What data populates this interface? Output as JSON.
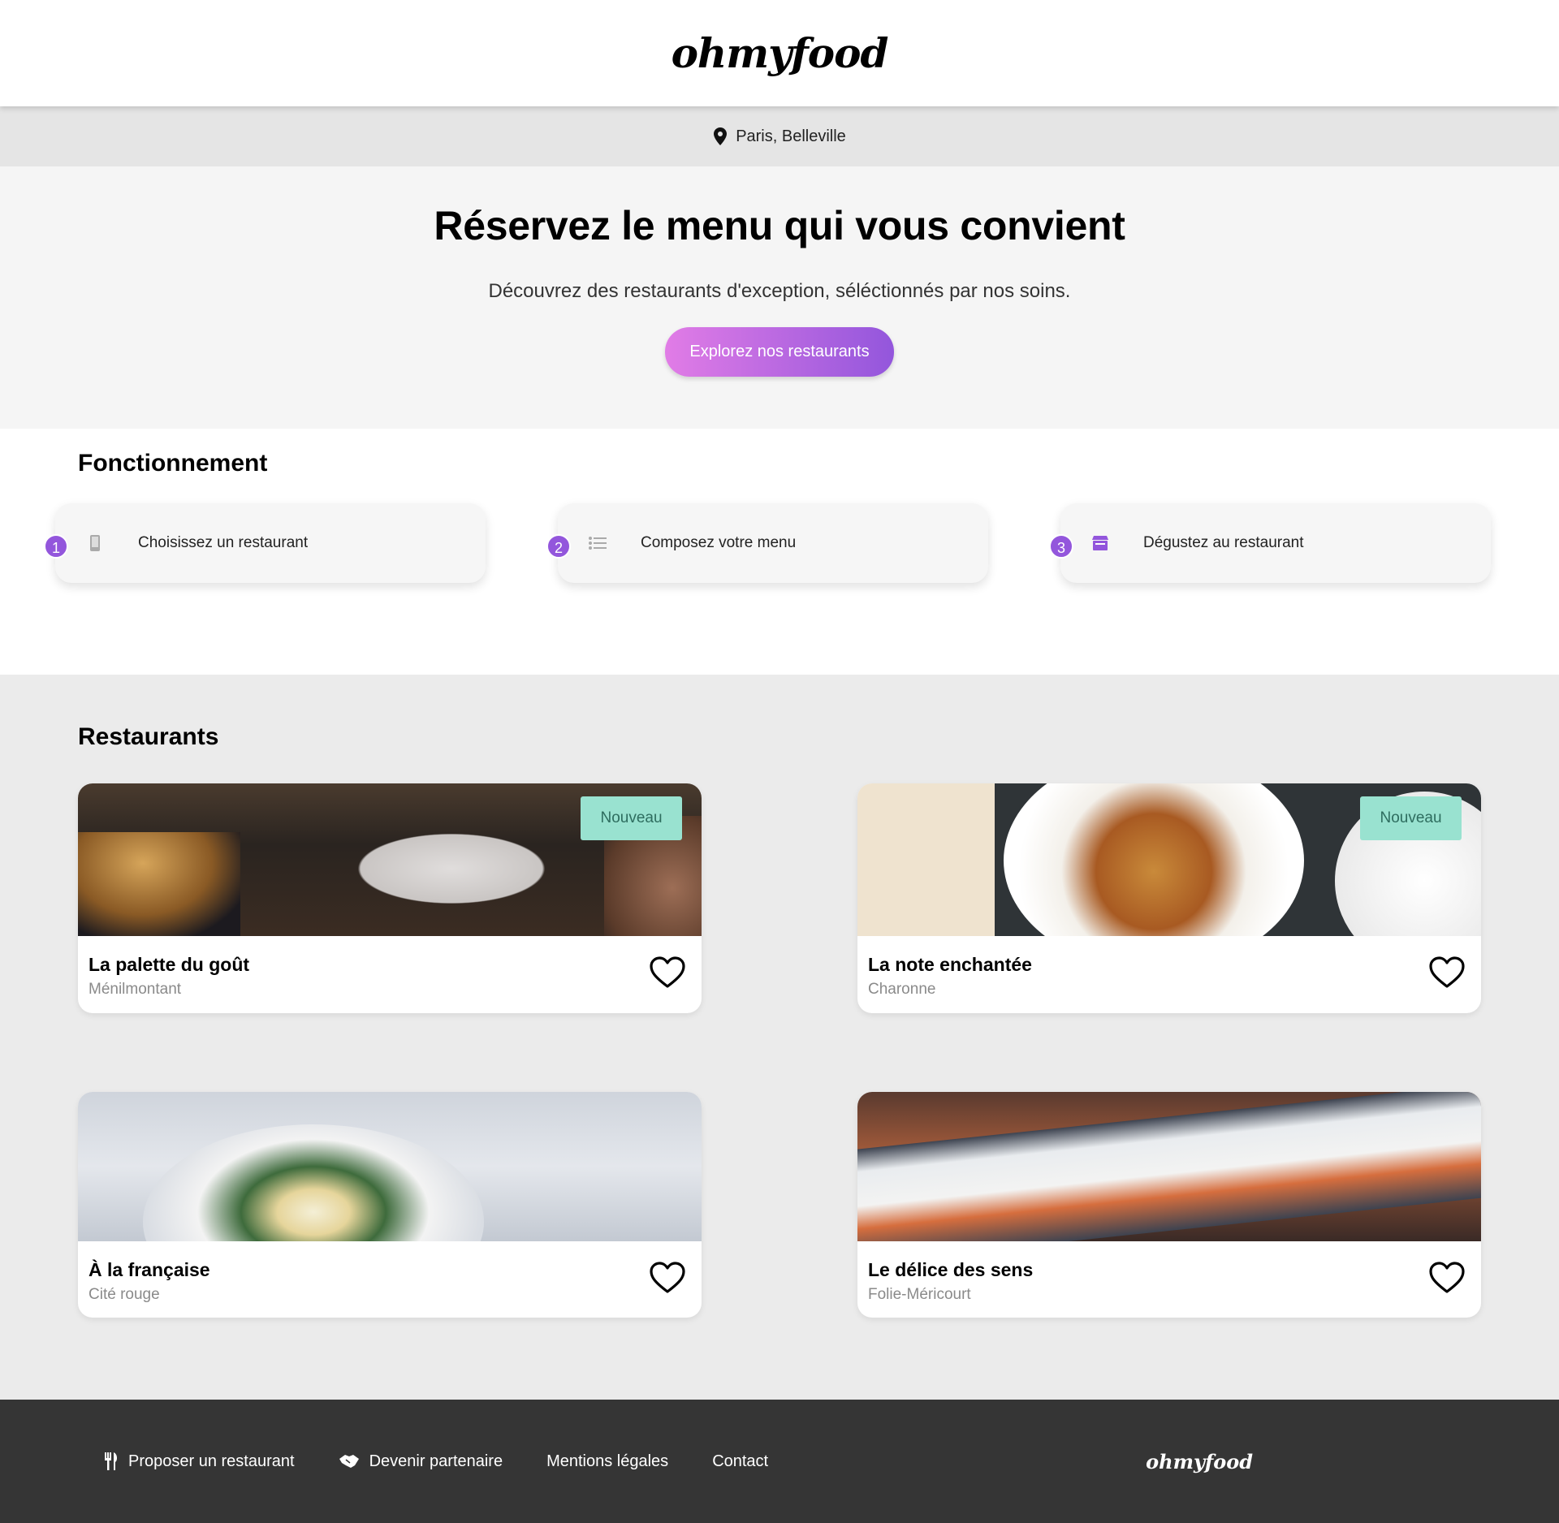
{
  "header": {
    "logo": "ohmyfood"
  },
  "location": {
    "icon": "map-pin-icon",
    "label": "Paris, Belleville"
  },
  "hero": {
    "title": "Réservez le menu qui vous convient",
    "subtitle": "Découvrez des restaurants d'exception, séléctionnés par nos soins.",
    "cta_label": "Explorez nos restaurants"
  },
  "how": {
    "title": "Fonctionnement",
    "steps": [
      {
        "number": "1",
        "icon": "mobile-phone-icon",
        "label": "Choisissez un restaurant"
      },
      {
        "number": "2",
        "icon": "list-icon",
        "label": "Composez votre menu"
      },
      {
        "number": "3",
        "icon": "store-icon",
        "label": "Dégustez au restaurant"
      }
    ]
  },
  "restaurants": {
    "title": "Restaurants",
    "items": [
      {
        "name": "La palette du goût",
        "area": "Ménilmontant",
        "badge": "Nouveau"
      },
      {
        "name": "La note enchantée",
        "area": "Charonne",
        "badge": "Nouveau"
      },
      {
        "name": "À la française",
        "area": "Cité rouge"
      },
      {
        "name": "Le délice des sens",
        "area": "Folie-Méricourt"
      }
    ]
  },
  "footer": {
    "links": [
      {
        "icon": "utensils-icon",
        "label": "Proposer un restaurant"
      },
      {
        "icon": "handshake-icon",
        "label": "Devenir partenaire"
      },
      {
        "label": "Mentions légales"
      },
      {
        "label": "Contact"
      }
    ],
    "logo": "ohmyfood"
  },
  "colors": {
    "accent": "#9356dc",
    "accent_light": "#e17ce6",
    "badge": "#99e2d0",
    "footer_bg": "#353535"
  }
}
